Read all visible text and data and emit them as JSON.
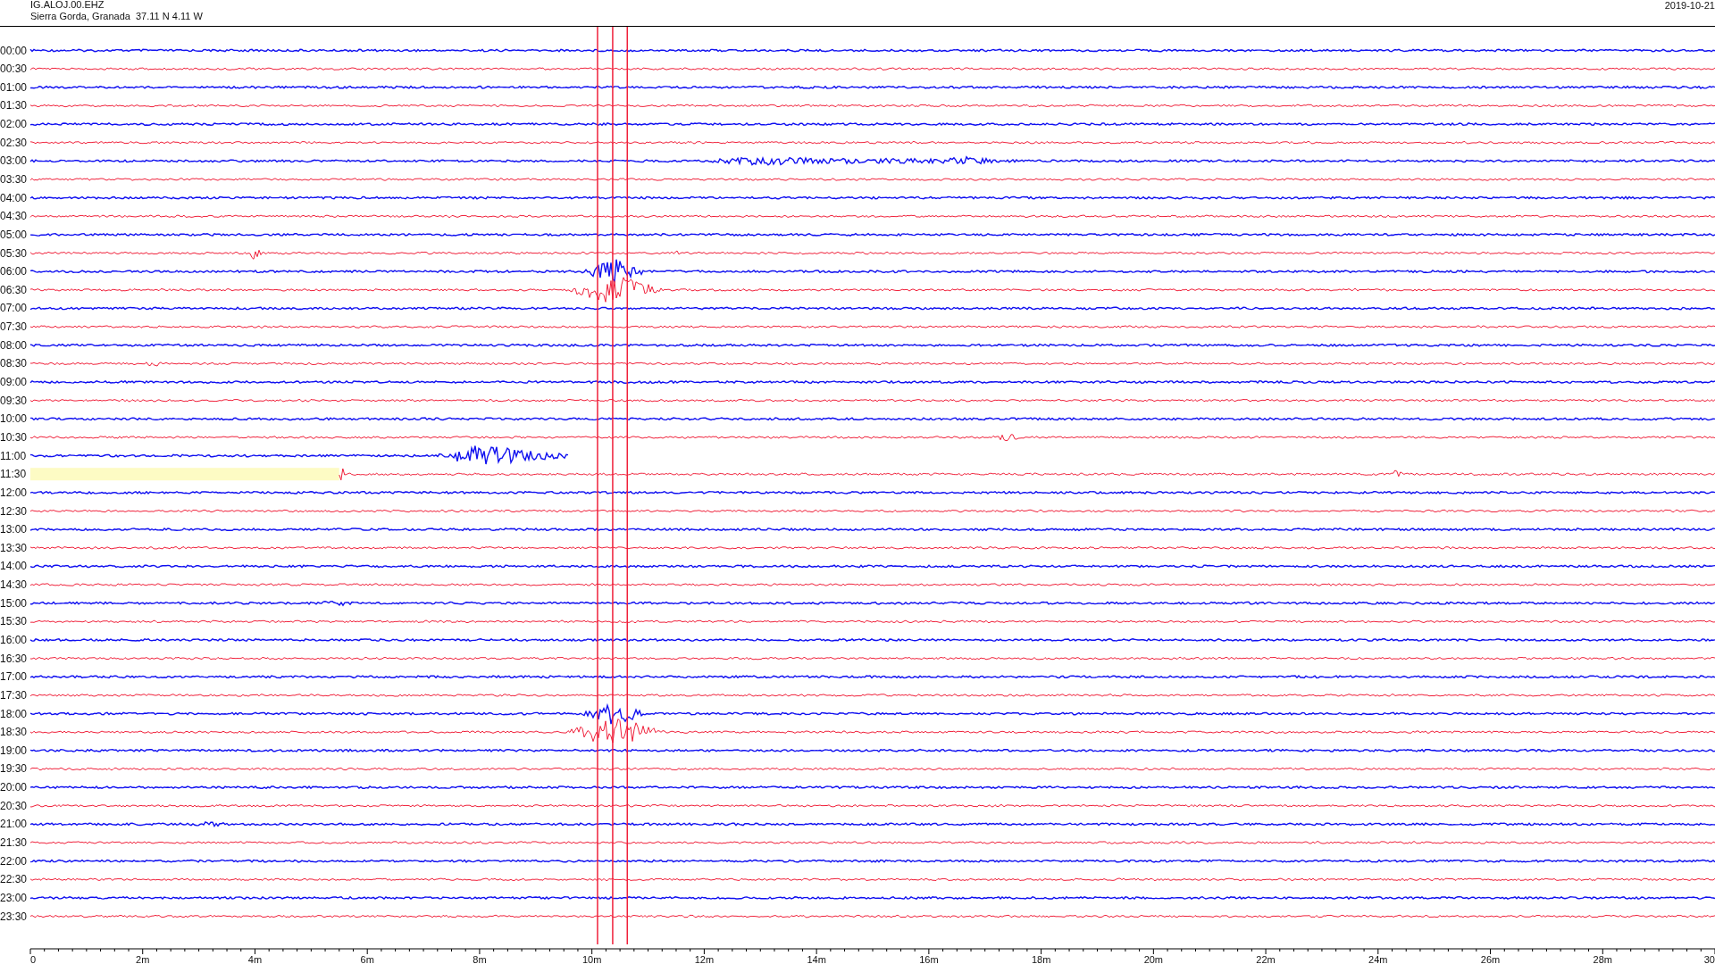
{
  "header": {
    "station": "IG.ALOJ.00.EHZ",
    "location": "Sierra Gorda, Granada  37.11 N 4.11 W",
    "date": "2019-10-21"
  },
  "rows": [
    {
      "label": "00:00",
      "gap": false
    },
    {
      "label": "00:30",
      "gap": false
    },
    {
      "label": "01:00",
      "gap": false
    },
    {
      "label": "01:30",
      "gap": false
    },
    {
      "label": "02:00",
      "gap": false
    },
    {
      "label": "02:30",
      "gap": false
    },
    {
      "label": "03:00",
      "gap": false
    },
    {
      "label": "03:30",
      "gap": false
    },
    {
      "label": "04:00",
      "gap": false
    },
    {
      "label": "04:30",
      "gap": false
    },
    {
      "label": "05:00",
      "gap": false
    },
    {
      "label": "05:30",
      "gap": false
    },
    {
      "label": "06:00",
      "gap": false
    },
    {
      "label": "06:30",
      "gap": false
    },
    {
      "label": "07:00",
      "gap": false
    },
    {
      "label": "07:30",
      "gap": false
    },
    {
      "label": "08:00",
      "gap": false
    },
    {
      "label": "08:30",
      "gap": false
    },
    {
      "label": "09:00",
      "gap": false
    },
    {
      "label": "09:30",
      "gap": false
    },
    {
      "label": "10:00",
      "gap": false
    },
    {
      "label": "10:30",
      "gap": false
    },
    {
      "label": "11:00",
      "gap": false
    },
    {
      "label": "11:30",
      "gap": true
    },
    {
      "label": "12:00",
      "gap": false
    },
    {
      "label": "12:30",
      "gap": false
    },
    {
      "label": "13:00",
      "gap": false
    },
    {
      "label": "13:30",
      "gap": false
    },
    {
      "label": "14:00",
      "gap": false
    },
    {
      "label": "14:30",
      "gap": false
    },
    {
      "label": "15:00",
      "gap": false
    },
    {
      "label": "15:30",
      "gap": false
    },
    {
      "label": "16:00",
      "gap": false
    },
    {
      "label": "16:30",
      "gap": false
    },
    {
      "label": "17:00",
      "gap": false
    },
    {
      "label": "17:30",
      "gap": false
    },
    {
      "label": "18:00",
      "gap": false
    },
    {
      "label": "18:30",
      "gap": false
    },
    {
      "label": "19:00",
      "gap": false
    },
    {
      "label": "19:30",
      "gap": false
    },
    {
      "label": "20:00",
      "gap": false
    },
    {
      "label": "20:30",
      "gap": false
    },
    {
      "label": "21:00",
      "gap": false
    },
    {
      "label": "21:30",
      "gap": false
    },
    {
      "label": "22:00",
      "gap": false
    },
    {
      "label": "22:30",
      "gap": false
    },
    {
      "label": "23:00",
      "gap": false
    },
    {
      "label": "23:30",
      "gap": false
    }
  ],
  "x_axis": {
    "labels": [
      "0",
      "2m",
      "4m",
      "6m",
      "8m",
      "10m",
      "12m",
      "14m",
      "16m",
      "18m",
      "20m",
      "22m",
      "24m",
      "26m",
      "28m",
      "30"
    ]
  }
}
